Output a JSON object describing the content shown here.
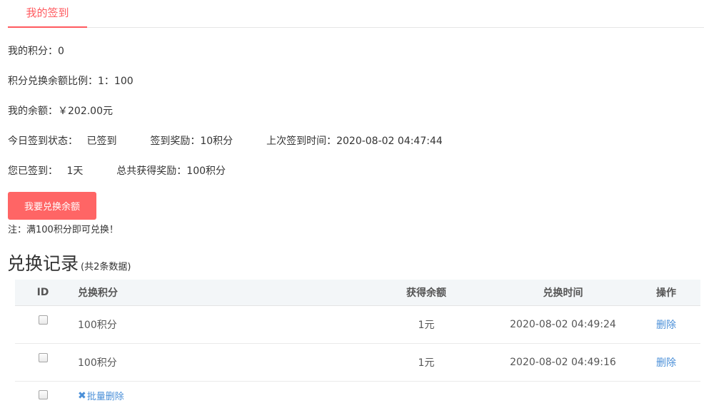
{
  "tab": {
    "label": "我的签到"
  },
  "info": {
    "points_label": "我的积分：",
    "points_value": "0",
    "ratio_label": "积分兑换余额比例：",
    "ratio_value": "1：100",
    "balance_label": "我的余额：",
    "balance_value": "￥202.00元",
    "status_label": "今日签到状态：",
    "status_value": "已签到",
    "reward_label": "签到奖励：",
    "reward_value": "10积分",
    "last_label": "上次签到时间：",
    "last_value": "2020-08-02 04:47:44",
    "days_label": "您已签到：",
    "days_value": "1天",
    "total_label": "总共获得奖励：",
    "total_value": "100积分"
  },
  "exchange_button": "我要兑换余额",
  "note": "注：满100积分即可兑换！",
  "records": {
    "title": "兑换记录",
    "count_text": "(共2条数据)",
    "headers": {
      "id": "ID",
      "points": "兑换积分",
      "balance": "获得余额",
      "time": "兑换时间",
      "op": "操作"
    },
    "rows": [
      {
        "points": "100积分",
        "balance": "1元",
        "time": "2020-08-02 04:49:24",
        "op": "删除"
      },
      {
        "points": "100积分",
        "balance": "1元",
        "time": "2020-08-02 04:49:16",
        "op": "删除"
      }
    ],
    "batch_delete": "批量删除"
  },
  "colors": {
    "accent": "#ff5a5f",
    "button": "#ff6565",
    "link": "#4a8fd8",
    "header_bg": "#f3f6f8"
  },
  "icons": {
    "batch_delete": "close-x-icon",
    "row_select": "checkbox"
  }
}
